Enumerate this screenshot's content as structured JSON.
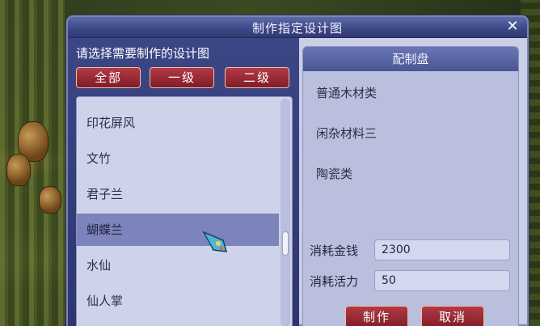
{
  "window": {
    "title": "制作指定设计图",
    "close_label": "✕"
  },
  "left": {
    "prompt": "请选择需要制作的设计图",
    "filters": [
      {
        "label": "全部"
      },
      {
        "label": "一级"
      },
      {
        "label": "二级"
      }
    ],
    "items": [
      {
        "label": "印花屏风",
        "selected": false
      },
      {
        "label": "文竹",
        "selected": false
      },
      {
        "label": "君子兰",
        "selected": false
      },
      {
        "label": "蝴蝶兰",
        "selected": true
      },
      {
        "label": "水仙",
        "selected": false
      },
      {
        "label": "仙人掌",
        "selected": false
      }
    ]
  },
  "right": {
    "header": "配制盘",
    "materials": [
      "普通木材类",
      "闲杂材料三",
      "陶瓷类"
    ],
    "costs": {
      "money_label": "消耗金钱",
      "money_value": "2300",
      "energy_label": "消耗活力",
      "energy_value": "50"
    },
    "buttons": {
      "make": "制作",
      "cancel": "取消"
    }
  },
  "colors": {
    "accent_red": "#b23a45",
    "title_blue": "#3b4685",
    "selection": "#7d84bb"
  },
  "icons": {
    "cursor": "gem-cursor-icon",
    "close": "close-icon"
  }
}
